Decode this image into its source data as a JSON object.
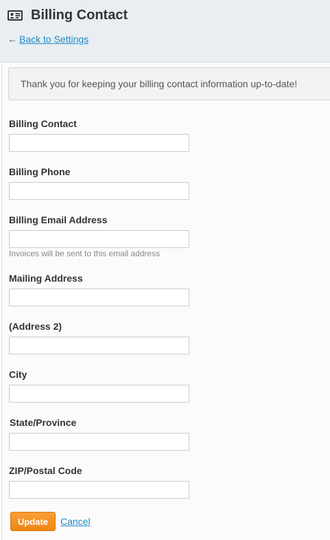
{
  "header": {
    "title": "Billing Contact",
    "icon": "contact-card-icon",
    "back_arrow": "←",
    "back_link": "Back to Settings"
  },
  "notice": {
    "text": "Thank you for keeping your billing contact information up-to-date!"
  },
  "form": {
    "fields": [
      {
        "label": "Billing Contact",
        "value": "",
        "help": ""
      },
      {
        "label": "Billing Phone",
        "value": "",
        "help": ""
      },
      {
        "label": "Billing Email Address",
        "value": "",
        "help": "Invoices will be sent to this email address"
      },
      {
        "label": "Mailing Address",
        "value": "",
        "help": ""
      },
      {
        "label": "(Address 2)",
        "value": "",
        "help": ""
      },
      {
        "label": "City",
        "value": "",
        "help": ""
      },
      {
        "label": "State/Province",
        "value": "",
        "help": ""
      },
      {
        "label": "ZIP/Postal Code",
        "value": "",
        "help": ""
      }
    ],
    "submit_label": "Update",
    "cancel_label": "Cancel"
  },
  "colors": {
    "header_bg": "#e8eef1",
    "link": "#1e88c7",
    "accent": "#ef8512"
  }
}
